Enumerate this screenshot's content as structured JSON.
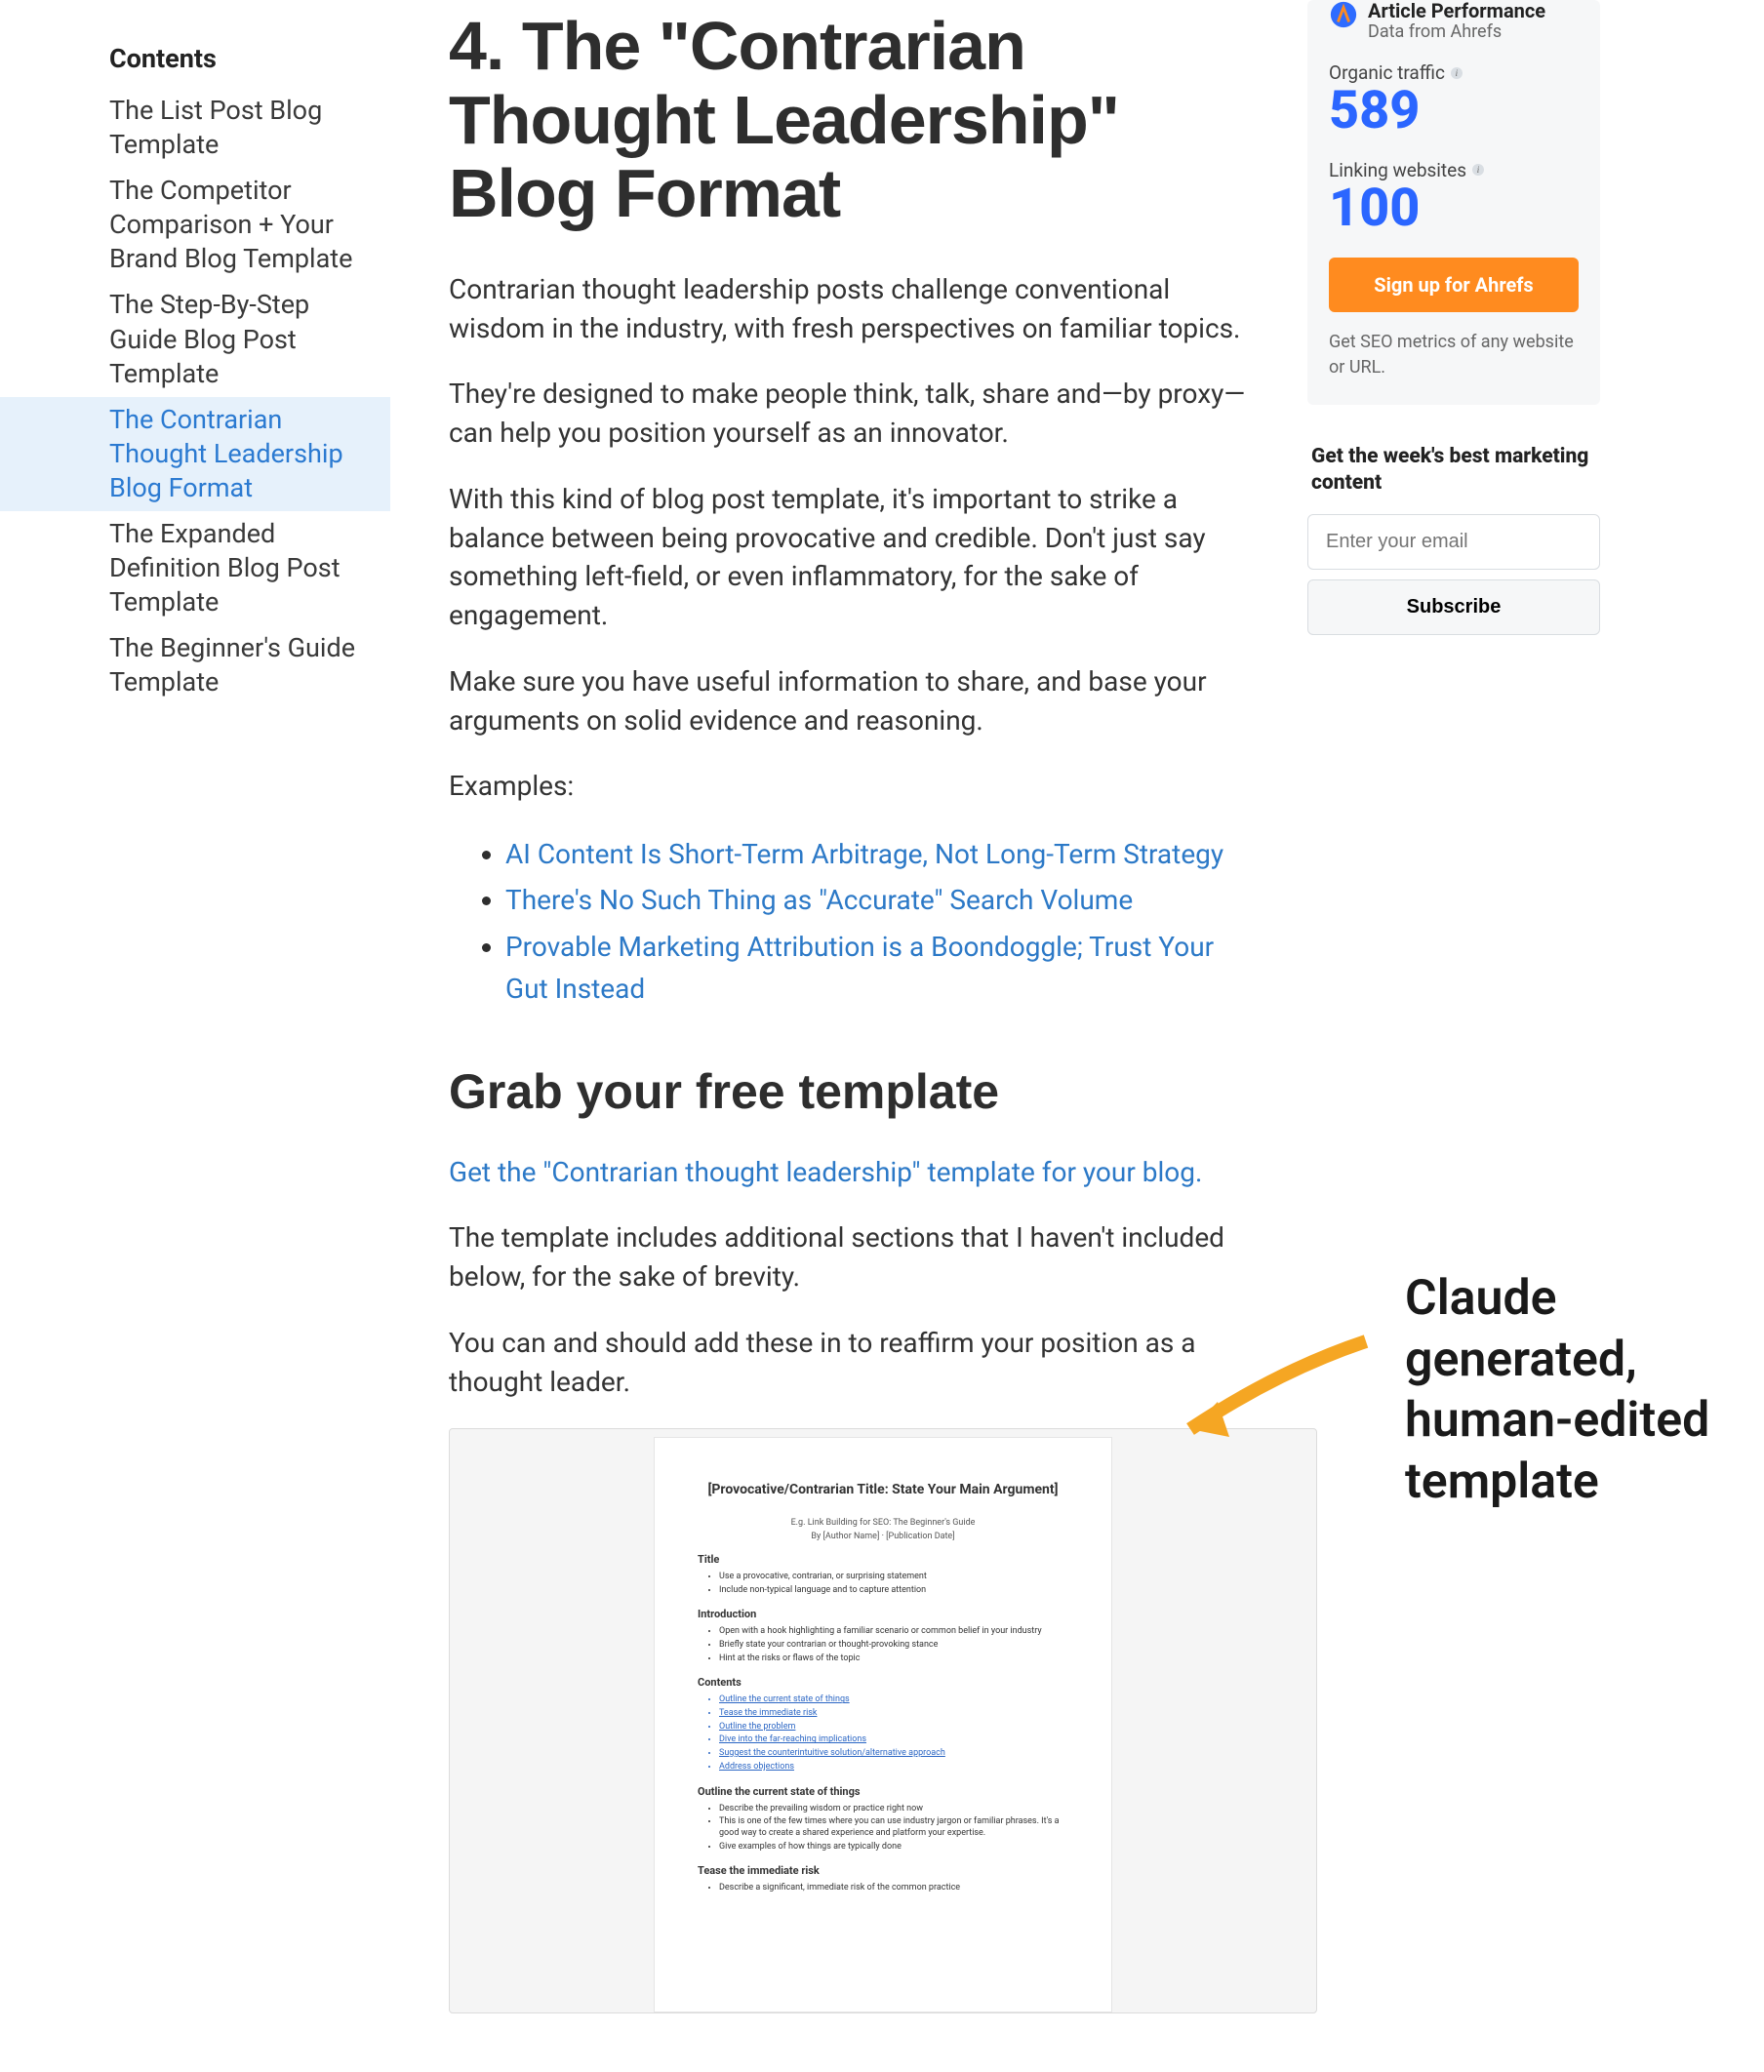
{
  "sidebar": {
    "heading": "Contents",
    "items": [
      {
        "label": "The List Post Blog Template",
        "active": false
      },
      {
        "label": "The Competitor Comparison + Your Brand Blog Template",
        "active": false
      },
      {
        "label": "The Step-By-Step Guide Blog Post Template",
        "active": false
      },
      {
        "label": "The Contrarian Thought Leadership Blog Format",
        "active": true
      },
      {
        "label": "The Expanded Definition Blog Post Template",
        "active": false
      },
      {
        "label": "The Beginner's Guide Template",
        "active": false
      }
    ]
  },
  "article": {
    "h2": "4. The \"Contrarian Thought Leadership\" Blog Format",
    "p1": "Contrarian thought leadership posts challenge conventional wisdom in the industry, with fresh perspectives on familiar topics.",
    "p2": "They're designed to make people think, talk, share and—by proxy—can help you position yourself as an innovator.",
    "p3": "With this kind of blog post template, it's important to strike a balance between being provocative and credible. Don't just say something left-field, or even inflammatory, for the sake of engagement.",
    "p4": "Make sure you have useful information to share, and base your arguments on solid evidence and reasoning.",
    "examples_label": "Examples:",
    "examples": [
      "AI Content Is Short-Term Arbitrage, Not Long-Term Strategy",
      "There's No Such Thing as \"Accurate\" Search Volume",
      "Provable Marketing Attribution is a Boondoggle; Trust Your Gut Instead"
    ],
    "h3": "Grab your free template",
    "template_link": "Get the \"Contrarian thought leadership\" template for your blog.",
    "p5": "The template includes additional sections that I haven't included below, for the sake of brevity.",
    "p6": "You can and should add these in to reaffirm your position as a thought leader."
  },
  "doc": {
    "title": "[Provocative/Contrarian Title: State Your Main Argument]",
    "eg1": "E.g. Link Building for SEO: The Beginner's Guide",
    "eg2": "By [Author Name] · [Publication Date]",
    "sec_title": "Title",
    "title_items": [
      "Use a provocative, contrarian, or surprising statement",
      "Include non-typical language and to capture attention"
    ],
    "sec_intro": "Introduction",
    "intro_items": [
      "Open with a hook highlighting a familiar scenario or common belief in your industry",
      "Briefly state your contrarian or thought-provoking stance",
      "Hint at the risks or flaws of the topic"
    ],
    "sec_contents": "Contents",
    "contents_items": [
      "Outline the current state of things",
      "Tease the immediate risk",
      "Outline the problem",
      "Dive into the far-reaching implications",
      "Suggest the counterintuitive solution/alternative approach",
      "Address objections"
    ],
    "sec_outline": "Outline the current state of things",
    "outline_items": [
      "Describe the prevailing wisdom or practice right now",
      "This is one of the few times where you can use industry jargon or familiar phrases. It's a good way to create a shared experience and platform your expertise.",
      "Give examples of how things are typically done"
    ],
    "sec_tease": "Tease the immediate risk",
    "tease_items": [
      "Describe a significant, immediate risk of the common practice"
    ]
  },
  "annotation": {
    "text": "Claude generated, human-edited template"
  },
  "perf": {
    "title": "Article Performance",
    "sub": "Data from Ahrefs",
    "traffic_label": "Organic traffic",
    "traffic_value": "589",
    "linking_label": "Linking websites",
    "linking_value": "100",
    "cta": "Sign up for Ahrefs",
    "foot": "Get SEO metrics of any website or URL."
  },
  "newsletter": {
    "heading": "Get the week's best marketing content",
    "placeholder": "Enter your email",
    "button": "Subscribe"
  }
}
